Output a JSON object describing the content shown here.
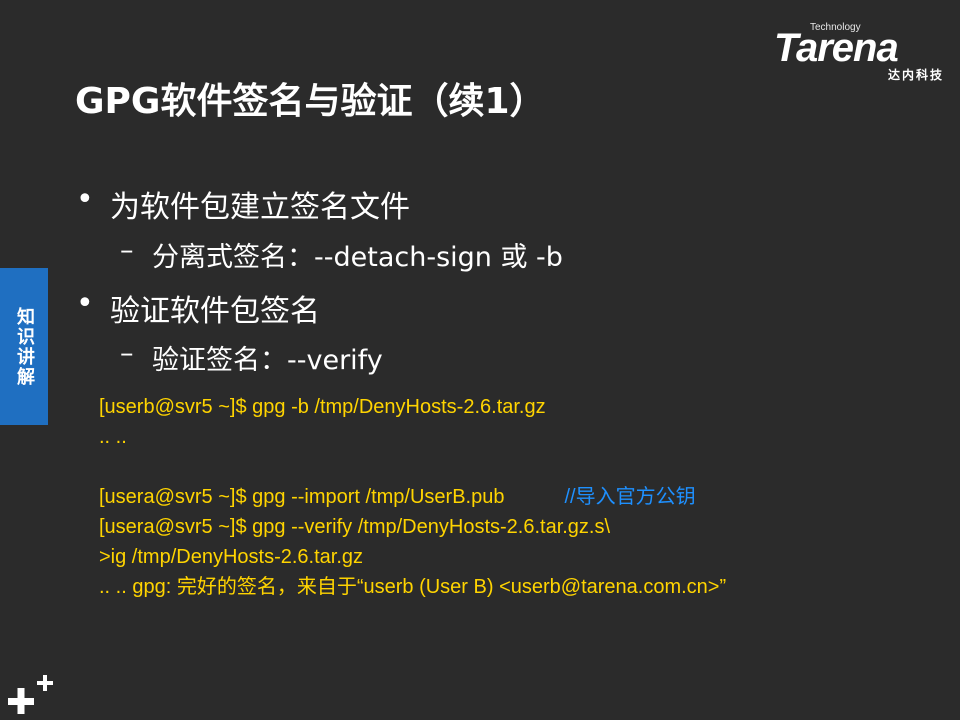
{
  "logo": {
    "technology": "Technology",
    "wordmark": "Tarena",
    "subtitle": "达内科技"
  },
  "title": "GPG软件签名与验证（续1）",
  "side_tab": "知识讲解",
  "bullets": [
    {
      "text": "为软件包建立签名文件",
      "sub": "分离式签名：--detach-sign 或 -b"
    },
    {
      "text": "验证软件包签名",
      "sub": "验证签名：--verify"
    }
  ],
  "code": {
    "line1": "[userb@svr5 ~]$ gpg  -b  /tmp/DenyHosts-2.6.tar.gz",
    "line2": ".. ..",
    "line3": "",
    "line4": "[usera@svr5 ~]$ gpg  --import  /tmp/UserB.pub",
    "line4_comment": "//导入官方公钥",
    "line5": "[usera@svr5 ~]$ gpg  --verify  /tmp/DenyHosts-2.6.tar.gz.s\\",
    "line6": ">ig  /tmp/DenyHosts-2.6.tar.gz",
    "line7": ".. .. gpg: 完好的签名，来自于“userb (User B) <userb@tarena.com.cn>”"
  },
  "colors": {
    "background": "#2b2b2b",
    "code": "#ffd400",
    "comment": "#1e90ff",
    "tab": "#1f6fc1"
  }
}
